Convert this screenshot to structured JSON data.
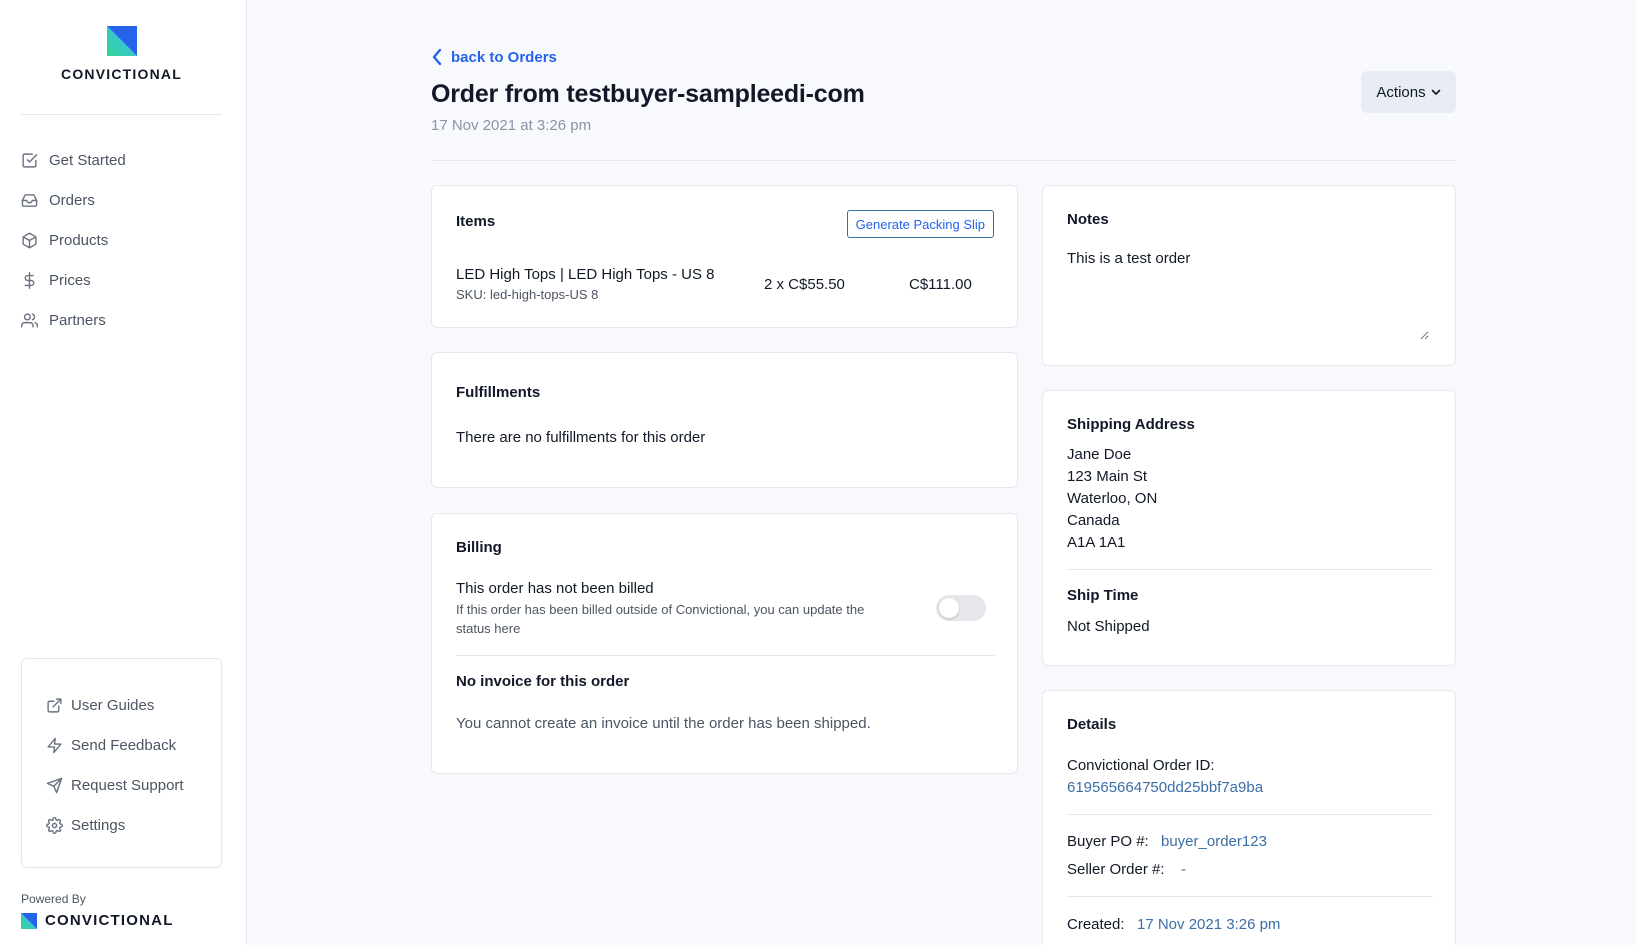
{
  "brand": {
    "name": "CONVICTIONAL",
    "powered_by": "Powered By",
    "accent": "#2563eb"
  },
  "nav": [
    {
      "label": "Get Started",
      "icon": "check-square-icon"
    },
    {
      "label": "Orders",
      "icon": "inbox-icon"
    },
    {
      "label": "Products",
      "icon": "box-icon"
    },
    {
      "label": "Prices",
      "icon": "dollar-icon"
    },
    {
      "label": "Partners",
      "icon": "users-icon"
    }
  ],
  "help": [
    {
      "label": "User Guides",
      "icon": "external-link-icon"
    },
    {
      "label": "Send Feedback",
      "icon": "zap-icon"
    },
    {
      "label": "Request Support",
      "icon": "send-icon"
    },
    {
      "label": "Settings",
      "icon": "gear-icon"
    }
  ],
  "header": {
    "back_label": "back to Orders",
    "title": "Order from testbuyer-sampleedi-com",
    "date": "17 Nov 2021 at 3:26 pm",
    "actions_label": "Actions"
  },
  "items": {
    "title": "Items",
    "packing_slip_label": "Generate Packing Slip",
    "rows": [
      {
        "name": "LED High Tops | LED High Tops - US 8",
        "sku": "SKU: led-high-tops-US 8",
        "qty_price": "2 x C$55.50",
        "total": "C$111.00"
      }
    ]
  },
  "fulfillments": {
    "title": "Fulfillments",
    "empty": "There are no fulfillments for this order"
  },
  "billing": {
    "title": "Billing",
    "status": "This order has not been billed",
    "hint_line1": "If this order has been billed outside of Convictional, you can update the",
    "hint_line2": "status here",
    "billed": false,
    "invoice_title": "No invoice for this order",
    "invoice_text": "You cannot create an invoice until the order has been shipped."
  },
  "notes": {
    "title": "Notes",
    "value": "This is a test order"
  },
  "shipping": {
    "title": "Shipping Address",
    "lines": [
      "Jane Doe",
      "123 Main St",
      "Waterloo, ON",
      "Canada",
      "A1A 1A1"
    ],
    "ship_time_title": "Ship Time",
    "ship_time": "Not Shipped"
  },
  "details": {
    "title": "Details",
    "order_id_label": "Convictional Order ID:",
    "order_id": "619565664750dd25bbf7a9ba",
    "buyer_po_label": "Buyer PO #:",
    "buyer_po": "buyer_order123",
    "seller_order_label": "Seller Order #:",
    "seller_order": "-",
    "created_label": "Created:",
    "created": "17 Nov 2021 3:26 pm"
  }
}
